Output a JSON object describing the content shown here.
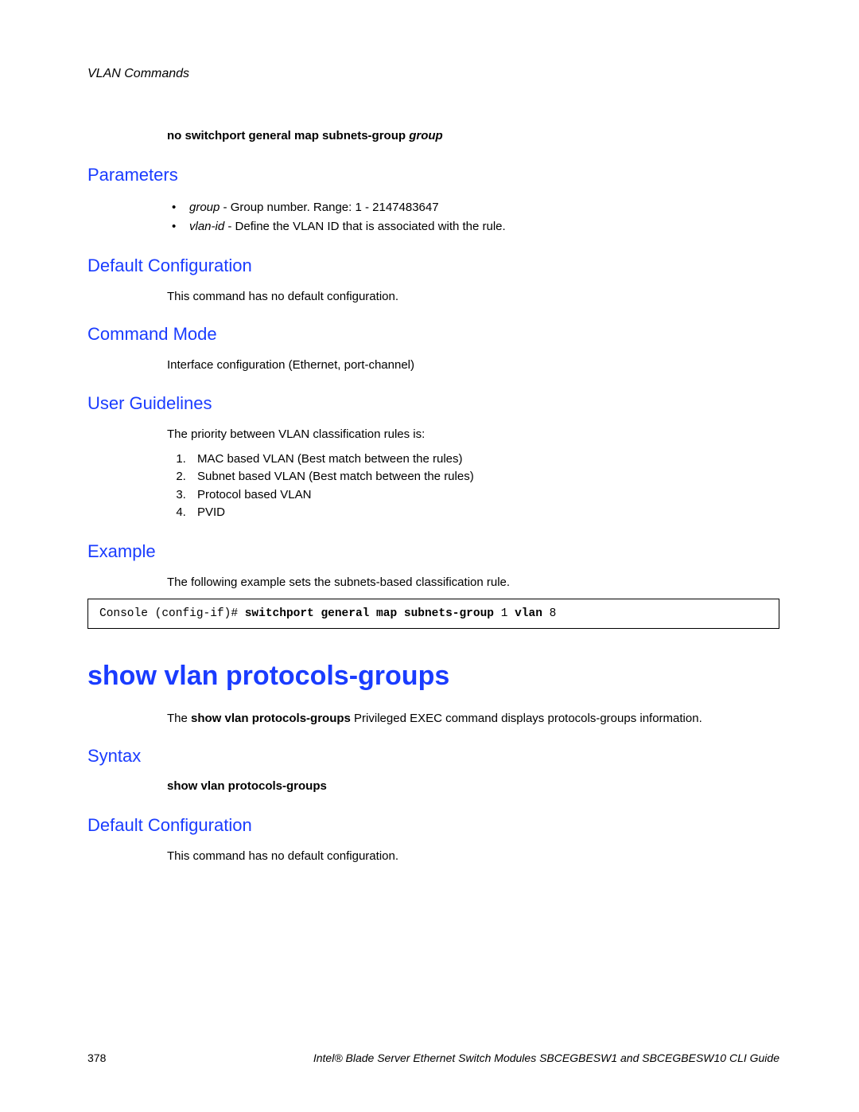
{
  "header": {
    "chapter": "VLAN Commands"
  },
  "cmd1": {
    "syntax_bold": "no switchport general map subnets-group",
    "syntax_ital": "group",
    "parameters_heading": "Parameters",
    "param_bullets": [
      {
        "ital": "group",
        "rest": " - Group number. Range: 1 - 2147483647"
      },
      {
        "ital": "vlan-id",
        "rest": " - Define the VLAN ID that is associated with the rule."
      }
    ],
    "default_cfg_heading": "Default Configuration",
    "default_cfg_text": "This command has no default configuration.",
    "cmd_mode_heading": "Command Mode",
    "cmd_mode_text": "Interface configuration (Ethernet, port-channel)",
    "user_guidelines_heading": "User Guidelines",
    "user_guidelines_intro": "The priority between VLAN classification rules is:",
    "priority_list": [
      "MAC based VLAN (Best match between the rules)",
      "Subnet based VLAN (Best match between the rules)",
      "Protocol based VLAN",
      "PVID"
    ],
    "example_heading": "Example",
    "example_text": "The following example sets the subnets-based classification rule.",
    "example_code_plain1": "Console (config-if)# ",
    "example_code_bold1": "switchport general map subnets-group",
    "example_code_plain2": " 1 ",
    "example_code_bold2": "vlan",
    "example_code_plain3": " 8"
  },
  "cmd2": {
    "title": "show vlan protocols-groups",
    "desc_pre": "The ",
    "desc_bold": "show vlan protocols-groups",
    "desc_post": " Privileged EXEC command displays protocols-groups informa­tion.",
    "syntax_heading": "Syntax",
    "syntax_text": "show vlan protocols-groups",
    "default_cfg_heading": "Default Configuration",
    "default_cfg_text": "This command has no default configuration."
  },
  "footer": {
    "page_number": "378",
    "guide": "Intel® Blade Server Ethernet Switch Modules SBCEGBESW1 and SBCEGBESW10 CLI Guide"
  }
}
